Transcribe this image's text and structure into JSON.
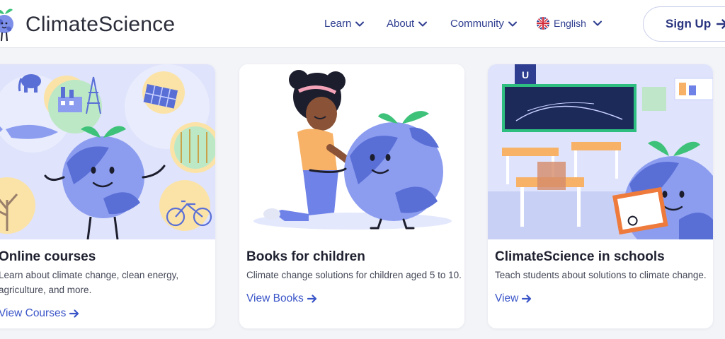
{
  "header": {
    "brand": "ClimateScience",
    "nav": [
      {
        "label": "Learn"
      },
      {
        "label": "About"
      },
      {
        "label": "Community"
      },
      {
        "label": "English"
      }
    ],
    "signup_label": "Sign Up"
  },
  "cards": [
    {
      "title": "Online courses",
      "desc_line1": "Learn about climate change, clean energy,",
      "desc_line2": "agriculture, and more.",
      "link": "View Courses"
    },
    {
      "title": "Books for children",
      "desc_line1": "Climate change solutions for children aged 5 to 10.",
      "link": "View Books"
    },
    {
      "title": "ClimateScience in schools",
      "desc_line1": "Teach students about solutions to climate change.",
      "link": "View"
    }
  ],
  "colors": {
    "accent": "#3a55c8",
    "nav_text": "#2e3d8f",
    "earth_blue": "#7d8fe8",
    "leaf_green": "#3ec27a"
  }
}
